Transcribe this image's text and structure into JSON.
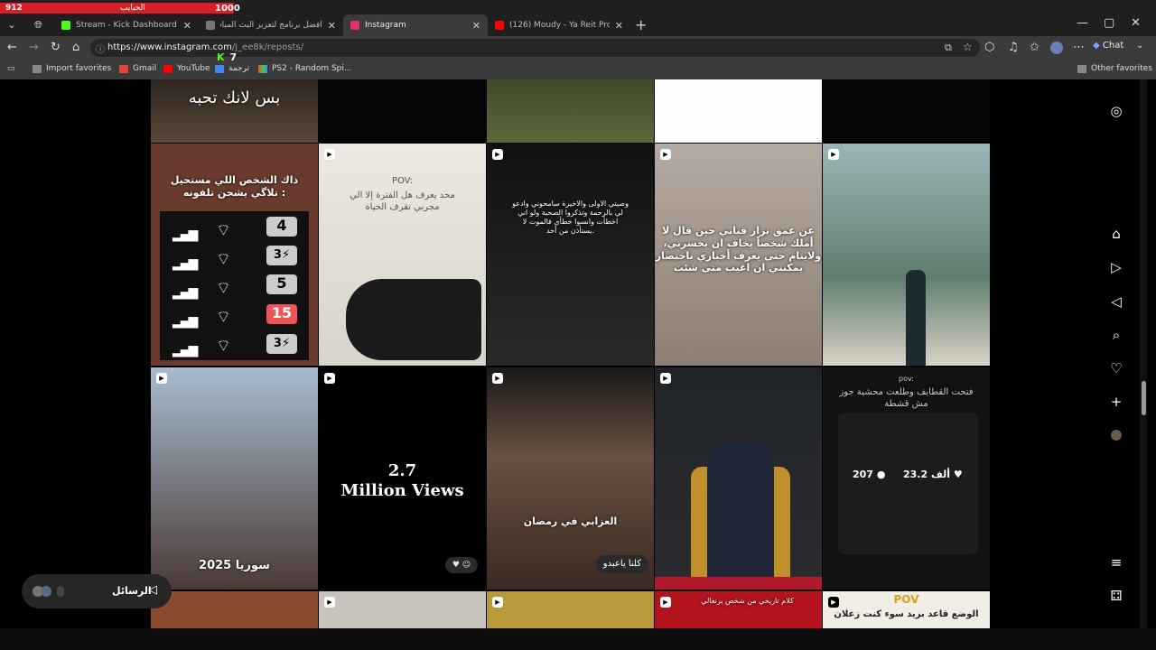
{
  "overlay": {
    "left_count": "912",
    "label": "الحبايب",
    "right_count": "1000"
  },
  "tabs": [
    {
      "title": "Stream - Kick Dashboard",
      "color": "#53fc18"
    },
    {
      "title": "أفضل برنامج لتعزيز البث المباشر",
      "color": "#888888"
    },
    {
      "title": "Instagram",
      "color": "#e1306c"
    },
    {
      "title": "(126) Moudy - Ya Reit Prod by Or",
      "color": "#ff0000"
    }
  ],
  "toolbar": {
    "url_host": "https://www.instagram.com",
    "url_path": "/j_ee8k/reposts/",
    "chat_label": "Chat"
  },
  "kick_badge": "7",
  "bookmarks": [
    {
      "label": "Import favorites"
    },
    {
      "label": "Gmail"
    },
    {
      "label": "YouTube"
    },
    {
      "label": "ترجمة"
    },
    {
      "label": "PS2 - Random Spi..."
    }
  ],
  "other_favorites": "Other favorites",
  "tiles": {
    "t0": "بس لانك تحبه",
    "r1c1_title": "ذاك الشخص اللي مستحيل تلاگي يشحن تلفونه :",
    "r1c1_nums": [
      "4",
      "3⚡",
      "5",
      "15",
      "3⚡"
    ],
    "r1c2_pov": "POV:",
    "r1c2_text": "محد يعرف هل الفترة إلا الي مجربي تقرف الحياة",
    "r1c3_text": "وصيتي الاولى والاخيرة سامحوني وادعو لي بالرحمة وتذكروا الصحبة ولو اني اخطأت وانسوا خطأي فالموت لا يستأذن من أحد.",
    "r1c4_text": "عن عمق نزار قباني حين قال لا أملك شخصاً يخاف ان يخسرني، ولاينام حتى يعرف أخباري باختصار يمكنني ان اغيب متى شئت",
    "r2c1_caption": "سوريا 2025",
    "r2c2_line1": "2.7",
    "r2c2_line2": "Million Views",
    "r2c3_caption": "العزابي في رمضان",
    "r2c3_bubble": "كلنا ياعبدو",
    "r2c5_pov": "pov:",
    "r2c5_text": "فتحت القطايف وطلعت محشية جوز مش قشطة",
    "r2c5_likes": "23.2 ألف",
    "r2c5_comments": "207",
    "r3c4_text": "كلام تاريخي من شخص برنغالي",
    "r3c5_pov": "POV",
    "r3c5_text": "الوضع قاعد بزيد سوء كنت زعلان"
  },
  "messages_label": "الرسائل",
  "colors": {
    "accent_red": "#d81e27",
    "kick_green": "#53fc18",
    "page_bg": "#000000"
  }
}
